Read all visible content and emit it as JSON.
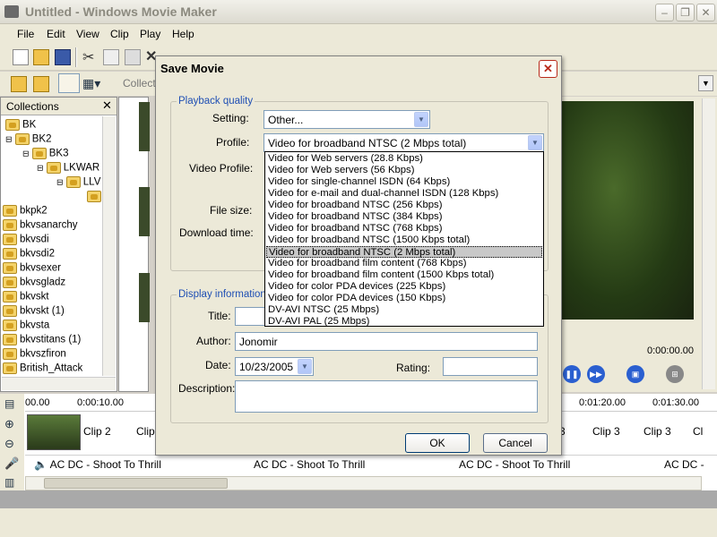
{
  "window": {
    "title": "Untitled - Windows Movie Maker"
  },
  "menu": [
    "File",
    "Edit",
    "View",
    "Clip",
    "Play",
    "Help"
  ],
  "toolbar2": {
    "collections_label": "Collecti"
  },
  "collections": {
    "title": "Collections",
    "items": [
      "BK",
      "BK2",
      "BK3",
      "LKWAR",
      "LLV",
      "bkpk2",
      "bkvsanarchy",
      "bkvsdi",
      "bkvsdi2",
      "bkvsexer",
      "bkvsgladz",
      "bkvskt",
      "bkvskt (1)",
      "bkvsta",
      "bkvstitans (1)",
      "bkvszfiron",
      "British_Attack"
    ]
  },
  "preview": {
    "time": "0:00:00.00"
  },
  "timeline": {
    "ruler": [
      "00.00",
      "0:00:10.00",
      "0:01:20.00",
      "0:01:30.00"
    ],
    "clips_left": [
      "Clip 2",
      "Clip"
    ],
    "clips_right": [
      "3",
      "Clip 3",
      "Clip 3",
      "Cl"
    ],
    "audio": [
      "AC DC - Shoot To Thrill",
      "AC DC - Shoot To Thrill",
      "AC DC - Shoot To Thrill",
      "AC DC -"
    ]
  },
  "dialog": {
    "title": "Save Movie",
    "playback_legend": "Playback quality",
    "setting_label": "Setting:",
    "setting_value": "Other...",
    "profile_label": "Profile:",
    "profile_value": "Video for broadband NTSC (2 Mbps total)",
    "video_profile_label": "Video Profile:",
    "file_size_label": "File size:",
    "download_time_label": "Download time:",
    "display_legend": "Display information",
    "title_label": "Title:",
    "title_value": "",
    "author_label": "Author:",
    "author_value": "Jonomir",
    "date_label": "Date:",
    "date_value": "10/23/2005",
    "rating_label": "Rating:",
    "rating_value": "",
    "description_label": "Description:",
    "description_value": "",
    "ok": "OK",
    "cancel": "Cancel",
    "profile_options": [
      "Video for Web servers (28.8 Kbps)",
      "Video for Web servers (56 Kbps)",
      "Video for single-channel ISDN (64 Kbps)",
      "Video for e-mail and dual-channel ISDN (128 Kbps)",
      "Video for broadband NTSC (256 Kbps)",
      "Video for broadband NTSC (384 Kbps)",
      "Video for broadband NTSC (768 Kbps)",
      "Video for broadband NTSC (1500 Kbps total)",
      "Video for broadband NTSC (2 Mbps total)",
      "Video for broadband film content (768 Kbps)",
      "Video for broadband film content (1500 Kbps total)",
      "Video for color PDA devices (225 Kbps)",
      "Video for color PDA devices (150 Kbps)",
      "DV-AVI NTSC (25 Mbps)",
      "DV-AVI PAL (25 Mbps)"
    ],
    "selected_index": 8
  },
  "colors": {
    "accent": "#1f4fb4",
    "selection": "#c8c8c8",
    "close_red": "#b82a1a"
  }
}
